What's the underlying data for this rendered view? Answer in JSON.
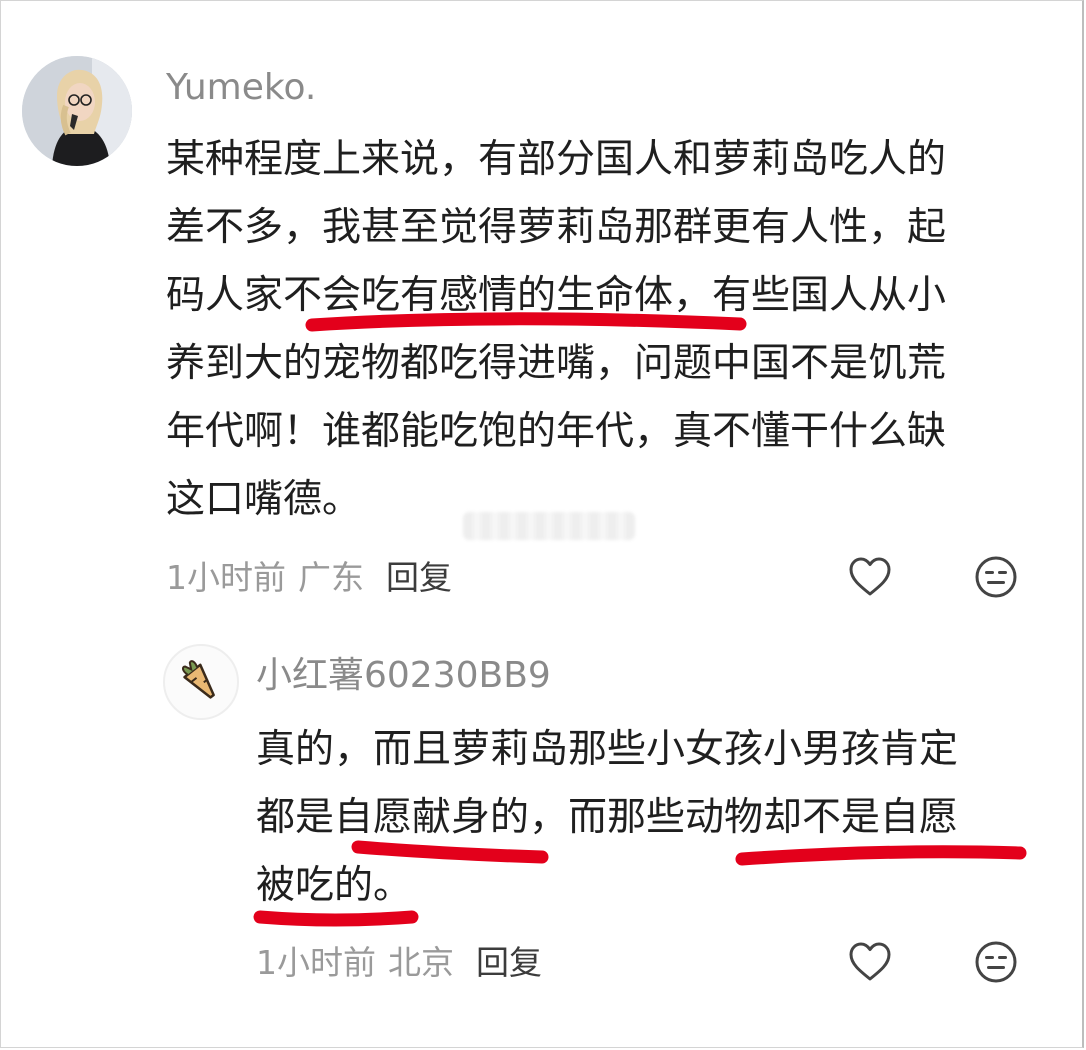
{
  "main_comment": {
    "username": "Yumeko.",
    "lines": [
      "某种程度上来说，有部分国人和萝莉岛吃人的",
      "差不多，我甚至觉得萝莉岛那群更有人性，起",
      "码人家不会吃有感情的生命体，有些国人从小",
      "养到大的宠物都吃得进嘴，问题中国不是饥荒",
      "年代啊！谁都能吃饱的年代，真不懂干什么缺",
      "这口嘴德。"
    ],
    "time": "1小时前",
    "location": "广东",
    "reply_label": "回复",
    "avatar_icon": "user-avatar-icon"
  },
  "reply_comment": {
    "username": "小红薯60230BB9",
    "lines": [
      "真的，而且萝莉岛那些小女孩小男孩肯定",
      "都是自愿献身的，而那些动物却不是自愿",
      "被吃的。"
    ],
    "time": "1小时前",
    "location": "北京",
    "reply_label": "回复",
    "avatar_icon": "carrot-icon"
  },
  "icons": {
    "like": "heart-outline-icon",
    "emoji": "neutral-face-icon"
  },
  "colors": {
    "annotation_underline": "#e3001b",
    "username": "#8a8a8a",
    "meta": "#9a9a9a",
    "body_text": "#1f1f1f"
  }
}
